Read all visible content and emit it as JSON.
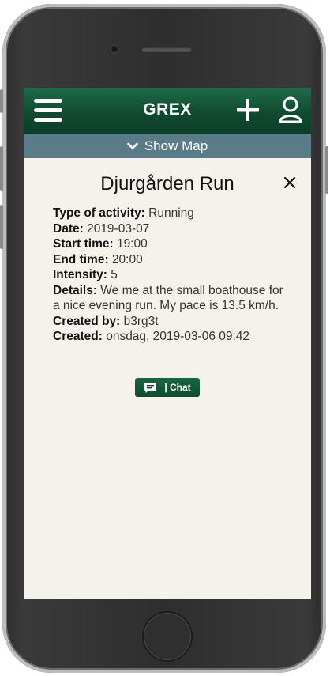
{
  "header": {
    "brand": "GREX"
  },
  "showmap": {
    "label": "Show Map"
  },
  "activity": {
    "title": "Djurgården Run",
    "fields": [
      {
        "label": "Type of activity:",
        "value": " Running"
      },
      {
        "label": "Date:",
        "value": " 2019-03-07"
      },
      {
        "label": "Start time:",
        "value": " 19:00"
      },
      {
        "label": "End time:",
        "value": " 20:00"
      },
      {
        "label": "Intensity:",
        "value": " 5"
      },
      {
        "label": "Details:",
        "value": " We me at the small boathouse for a nice evening run. My pace is 13.5 km/h."
      },
      {
        "label": "Created by:",
        "value": " b3rg3t"
      },
      {
        "label": "Created:",
        "value": " onsdag, 2019-03-06 09:42"
      }
    ]
  },
  "chat_button": {
    "label": "| Chat"
  },
  "icons": {
    "menu": "hamburger-menu-icon",
    "add": "plus-icon",
    "profile": "user-icon",
    "expand": "chevron-down-icon",
    "close": "close-icon",
    "chat": "chat-bubble-icon"
  },
  "colors": {
    "header": "#0f4a30",
    "showmap_bar": "#5a7b88",
    "screen_bg": "#f5f2ec",
    "chat_button": "#0d4a2f"
  }
}
